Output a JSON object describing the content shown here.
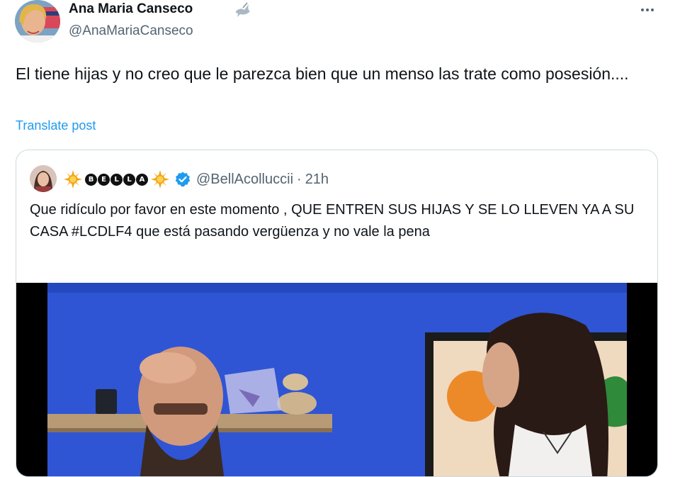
{
  "tweet": {
    "author_name": "Ana Maria Canseco",
    "author_handle": "@AnaMariaCanseco",
    "badge_icon": "dove-icon",
    "more_icon": "more-horizontal-icon",
    "text": "El tiene hijas y no creo que le parezca bien que un menso las trate como posesión....",
    "translate_label": "Translate post"
  },
  "quoted": {
    "display_name_letters": [
      "B",
      "E",
      "L",
      "L",
      "A"
    ],
    "name_decoration_icon": "sun-icon",
    "verified_icon": "verified-badge-icon",
    "handle": "@BellAcolluccii",
    "separator": "·",
    "time": "21h",
    "text": "Que ridículo por favor en este momento , QUE ENTREN SUS HIJAS Y SE LO LLEVEN YA A SU CASA #LCDLF4 que está pasando vergüenza y no vale la pena",
    "media_type": "video"
  },
  "colors": {
    "link_blue": "#1d9bf0",
    "secondary_text": "#536471",
    "border": "#cfd9de",
    "wall_blue": "#2f55d4"
  }
}
